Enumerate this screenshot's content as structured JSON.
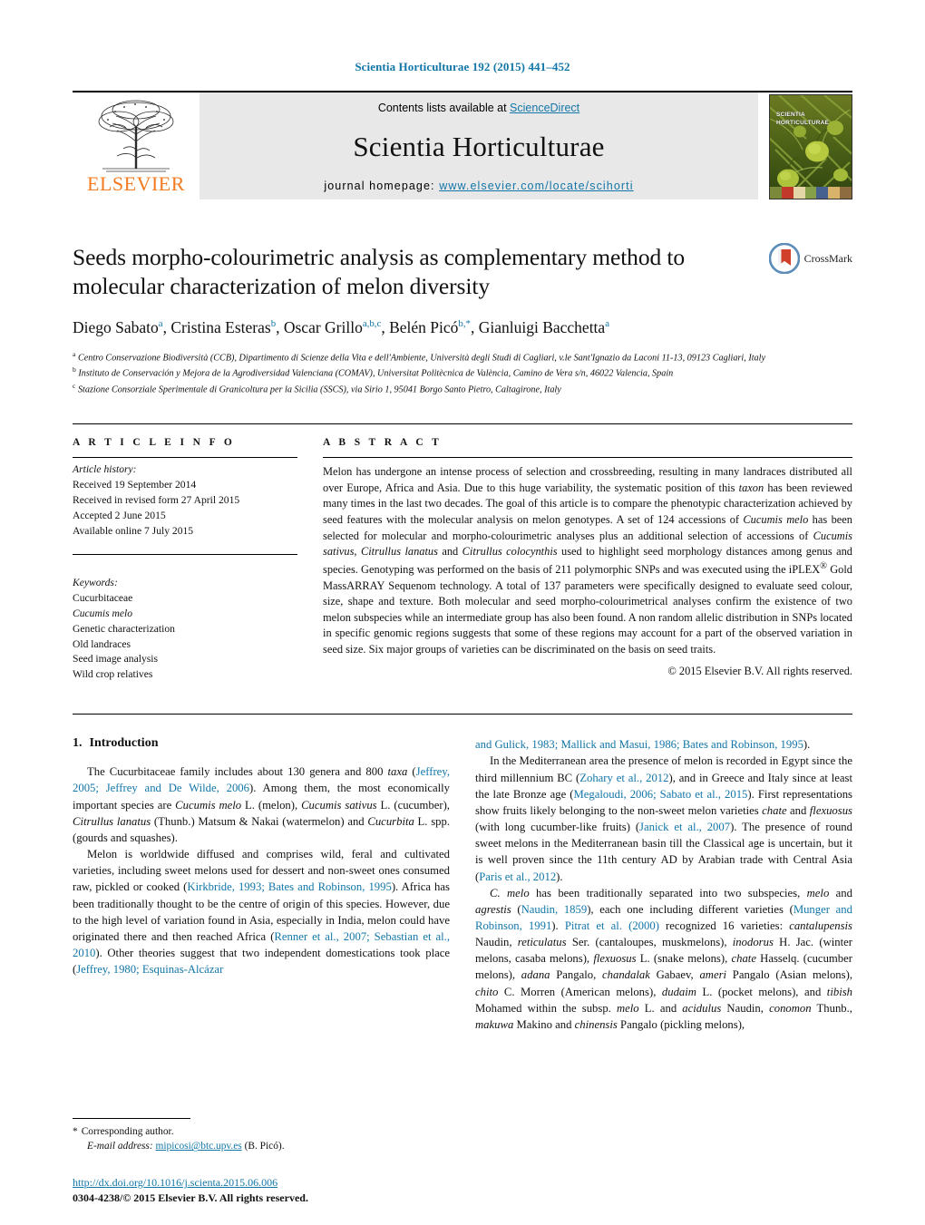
{
  "running_head": "Scientia Horticulturae 192 (2015) 441–452",
  "masthead": {
    "publisher_name": "ELSEVIER",
    "contents_prefix": "Contents lists available at ",
    "contents_link": "ScienceDirect",
    "journal_name": "Scientia Horticulturae",
    "homepage_prefix": "journal homepage: ",
    "homepage_url": "www.elsevier.com/locate/scihorti",
    "cover_title_line1": "SCIENTIA",
    "cover_title_line2": "HORTICULTURAE"
  },
  "article": {
    "title": "Seeds morpho-colourimetric analysis as complementary method to molecular characterization of melon diversity",
    "crossmark_label": "CrossMark",
    "authors_html": "Diego Sabato<sup>a</sup>, Cristina Esteras<sup>b</sup>, Oscar Grillo<sup>a,b,c</sup>, Belén Picó<sup>b,*</sup>, Gianluigi Bacchetta<sup>a</sup>",
    "affiliations": [
      "Centro Conservazione Biodiversità (CCB), Dipartimento di Scienze della Vita e dell'Ambiente, Università degli Studi di Cagliari, v.le Sant'Ignazio da Laconi 11-13, 09123 Cagliari, Italy",
      "Instituto de Conservación y Mejora de la Agrodiversidad Valenciana (COMAV), Universitat Politècnica de València, Camino de Vera s/n, 46022 Valencia, Spain",
      "Stazione Consorziale Sperimentale di Granicoltura per la Sicilia (SSCS), via Sirio 1, 95041 Borgo Santo Pietro, Caltagirone, Italy"
    ],
    "affiliation_marks": [
      "a",
      "b",
      "c"
    ]
  },
  "article_info": {
    "heading": "A R T I C L E   I N F O",
    "history_label": "Article history:",
    "history": [
      "Received 19 September 2014",
      "Received in revised form 27 April 2015",
      "Accepted 2 June 2015",
      "Available online 7 July 2015"
    ],
    "keywords_label": "Keywords:",
    "keywords": [
      "Cucurbitaceae",
      "Cucumis melo",
      "Genetic characterization",
      "Old landraces",
      "Seed image analysis",
      "Wild crop relatives"
    ],
    "keywords_italic_index": 1
  },
  "abstract": {
    "heading": "A B S T R A C T",
    "text_html": "Melon has undergone an intense process of selection and crossbreeding, resulting in many landraces distributed all over Europe, Africa and Asia. Due to this huge variability, the systematic position of this <span class=\"ital\">taxon</span> has been reviewed many times in the last two decades. The goal of this article is to compare the phenotypic characterization achieved by seed features with the molecular analysis on melon genotypes. A set of 124 accessions of <span class=\"ital\">Cucumis melo</span> has been selected for molecular and morpho-colourimetric analyses plus an additional selection of accessions of <span class=\"ital\">Cucumis sativus</span>, <span class=\"ital\">Citrullus lanatus</span> and <span class=\"ital\">Citrullus colocynthis</span> used to highlight seed morphology distances among genus and species. Genotyping was performed on the basis of 211 polymorphic SNPs and was executed using the iPLEX<sup>®</sup> Gold MassARRAY Sequenom technology. A total of 137 parameters were specifically designed to evaluate seed colour, size, shape and texture. Both molecular and seed morpho-colourimetrical analyses confirm the existence of two melon subspecies while an intermediate group has also been found. A non random allelic distribution in SNPs located in specific genomic regions suggests that some of these regions may account for a part of the observed variation in seed size. Six major groups of varieties can be discriminated on the basis on seed traits.",
    "copyright": "© 2015 Elsevier B.V. All rights reserved."
  },
  "body": {
    "section_number": "1.",
    "section_title": "Introduction",
    "left_paragraphs_html": [
      "The Cucurbitaceae family includes about 130 genera and 800 <span class=\"ital\">taxa</span> (<span class=\"ref\">Jeffrey, 2005; Jeffrey and De Wilde, 2006</span>). Among them, the most economically important species are <span class=\"ital\">Cucumis melo</span> L. (melon), <span class=\"ital\">Cucumis sativus</span> L. (cucumber), <span class=\"ital\">Citrullus lanatus</span> (Thunb.) Matsum &amp; Nakai (watermelon) and <span class=\"ital\">Cucurbita</span> L. spp. (gourds and squashes).",
      "Melon is worldwide diffused and comprises wild, feral and cultivated varieties, including sweet melons used for dessert and non-sweet ones consumed raw, pickled or cooked (<span class=\"ref\">Kirkbride, 1993; Bates and Robinson, 1995</span>). Africa has been traditionally thought to be the centre of origin of this species. However, due to the high level of variation found in Asia, especially in India, melon could have originated there and then reached Africa (<span class=\"ref\">Renner et al., 2007; Sebastian et al., 2010</span>). Other theories suggest that two independent domestications took place (<span class=\"ref\">Jeffrey, 1980; Esquinas-Alcázar</span>"
    ],
    "right_paragraphs_html": [
      "<span class=\"ref\">and Gulick, 1983; Mallick and Masui, 1986; Bates and Robinson, 1995</span>).",
      "In the Mediterranean area the presence of melon is recorded in Egypt since the third millennium BC (<span class=\"ref\">Zohary et al., 2012</span>), and in Greece and Italy since at least the late Bronze age (<span class=\"ref\">Megaloudi, 2006; Sabato et al., 2015</span>). First representations show fruits likely belonging to the non-sweet melon varieties <span class=\"ital\">chate</span> and <span class=\"ital\">flexuosus</span> (with long cucumber-like fruits) (<span class=\"ref\">Janick et al., 2007</span>). The presence of round sweet melons in the Mediterranean basin till the Classical age is uncertain, but it is well proven since the 11th century AD by Arabian trade with Central Asia (<span class=\"ref\">Paris et al., 2012</span>).",
      "<span class=\"ital\">C. melo</span> has been traditionally separated into two subspecies, <span class=\"ital\">melo</span> and <span class=\"ital\">agrestis</span> (<span class=\"ref\">Naudin, 1859</span>), each one including different varieties (<span class=\"ref\">Munger and Robinson, 1991</span>). <span class=\"ref\">Pitrat et al. (2000)</span> recognized 16 varieties: <span class=\"ital\">cantalupensis</span> Naudin, <span class=\"ital\">reticulatus</span> Ser. (cantaloupes, muskmelons), <span class=\"ital\">inodorus</span> H. Jac. (winter melons, casaba melons), <span class=\"ital\">flexuosus</span> L. (snake melons), <span class=\"ital\">chate</span> Hasselq. (cucumber melons), <span class=\"ital\">adana</span> Pangalo, <span class=\"ital\">chandalak</span> Gabaev, <span class=\"ital\">ameri</span> Pangalo (Asian melons), <span class=\"ital\">chito</span> C. Morren (American melons), <span class=\"ital\">dudaim</span> L. (pocket melons), and <span class=\"ital\">tibish</span> Mohamed within the subsp. <span class=\"ital\">melo</span> L. and <span class=\"ital\">acidulus</span> Naudin, <span class=\"ital\">conomon</span> Thunb., <span class=\"ital\">makuwa</span> Makino and <span class=\"ital\">chinensis</span> Pangalo (pickling melons),"
    ]
  },
  "footnote": {
    "corresponding_star": "*",
    "corresponding_label": "Corresponding author.",
    "email_label": "E-mail address:",
    "email": "mipicosi@btc.upv.es",
    "email_owner": "(B. Picó)."
  },
  "footer": {
    "doi": "http://dx.doi.org/10.1016/j.scienta.2015.06.006",
    "issn_copyright": "0304-4238/© 2015 Elsevier B.V. All rights reserved."
  },
  "colors": {
    "link": "#1276a8",
    "elsevier_orange": "#f47b20",
    "band_gray": "#e8e8e8"
  }
}
